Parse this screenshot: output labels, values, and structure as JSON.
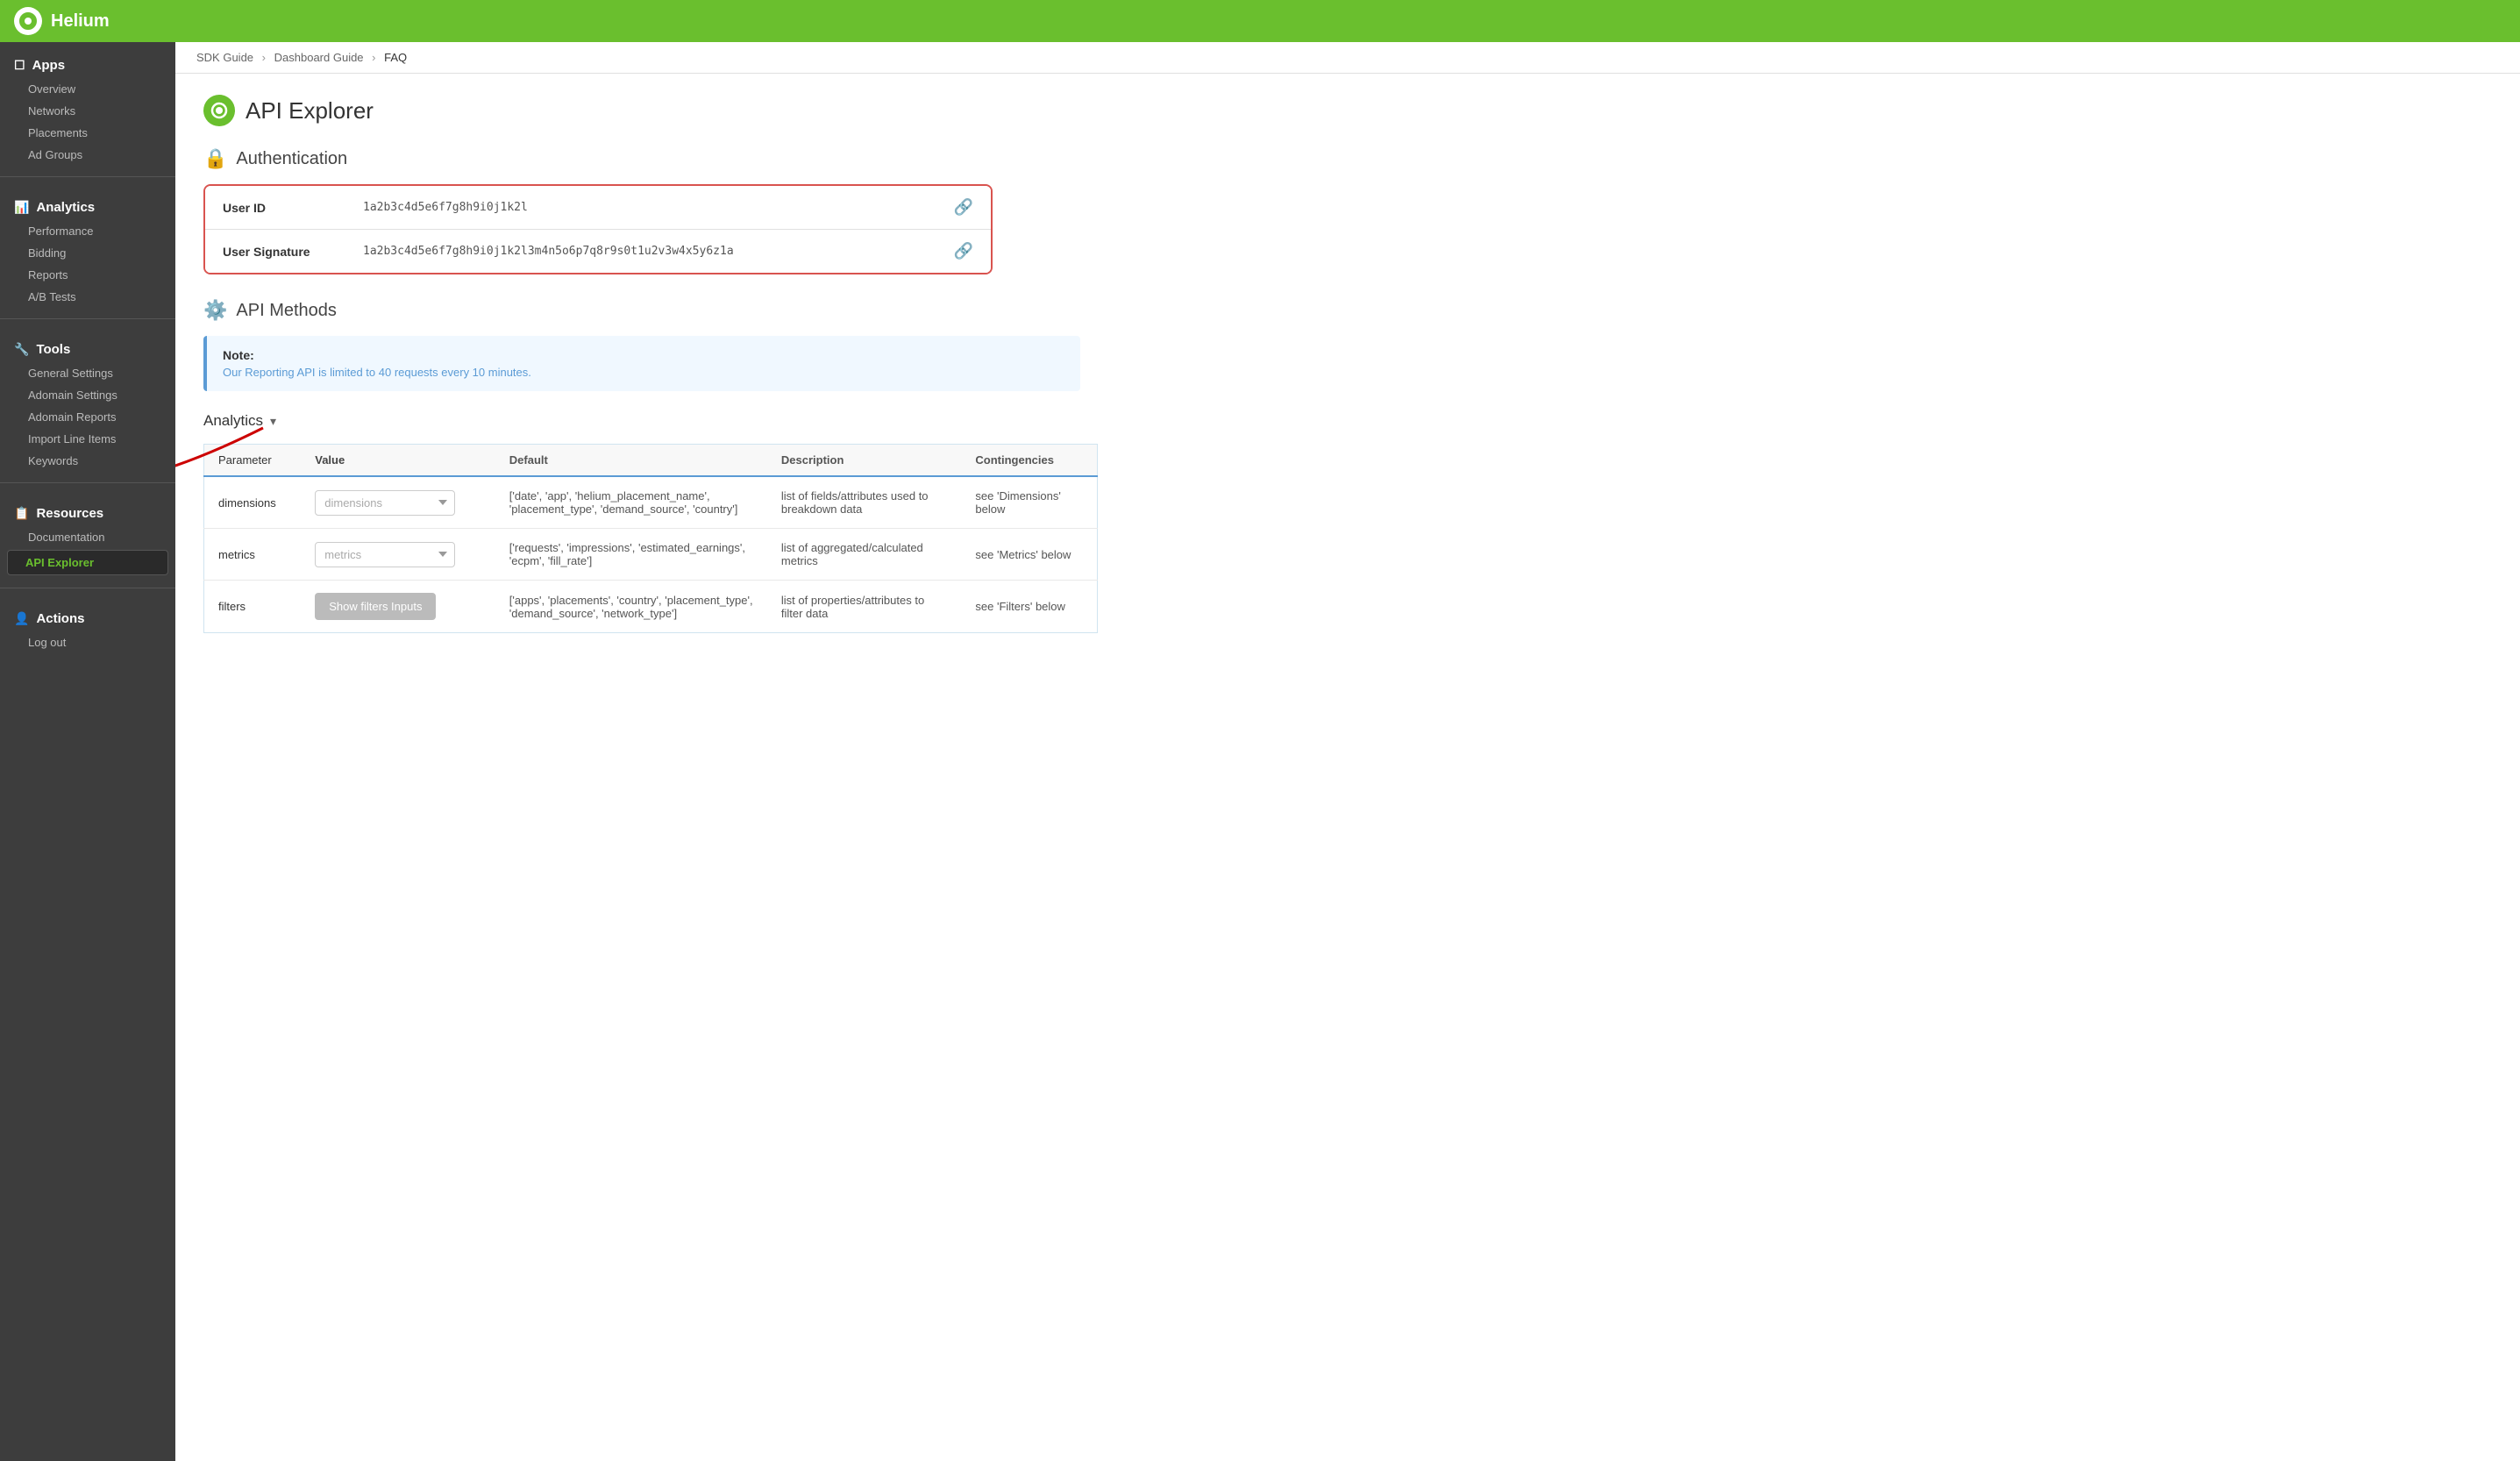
{
  "topbar": {
    "logo_text": "Helium"
  },
  "breadcrumb": {
    "items": [
      "SDK Guide",
      "Dashboard Guide",
      "FAQ"
    ],
    "separators": [
      "›",
      "›"
    ]
  },
  "sidebar": {
    "sections": [
      {
        "id": "apps",
        "icon": "📱",
        "label": "Apps",
        "items": [
          "Overview",
          "Networks",
          "Placements",
          "Ad Groups"
        ]
      },
      {
        "id": "analytics",
        "icon": "📊",
        "label": "Analytics",
        "items": [
          "Performance",
          "Bidding",
          "Reports",
          "A/B Tests"
        ]
      },
      {
        "id": "tools",
        "icon": "🔧",
        "label": "Tools",
        "items": [
          "General Settings",
          "Adomain Settings",
          "Adomain Reports",
          "Import Line Items",
          "Keywords"
        ]
      },
      {
        "id": "resources",
        "icon": "📋",
        "label": "Resources",
        "items": [
          "Documentation",
          "API Explorer"
        ]
      },
      {
        "id": "actions",
        "icon": "👤",
        "label": "Actions",
        "items": [
          "Log out"
        ]
      }
    ]
  },
  "page": {
    "title": "API Explorer",
    "auth_section_title": "Authentication",
    "api_methods_title": "API Methods",
    "analytics_toggle": "Analytics",
    "note_title": "Note:",
    "note_body": "Our Reporting API is limited to 40 requests every 10 minutes.",
    "user_id_label": "User ID",
    "user_id_value": "1a2b3c4d5e6f7g8h9i0j1k2l",
    "user_signature_label": "User Signature",
    "user_signature_value": "1a2b3c4d5e6f7g8h9i0j1k2l3m4n5o6p7q8r9s0t1u2v3w4x5y6z1a",
    "table": {
      "columns": [
        "Parameter",
        "Value",
        "Default",
        "Description",
        "Contingencies"
      ],
      "rows": [
        {
          "parameter": "dimensions",
          "value_placeholder": "dimensions",
          "default": "['date', 'app', 'helium_placement_name', 'placement_type', 'demand_source', 'country']",
          "description": "list of fields/attributes used to breakdown data",
          "contingencies": "see 'Dimensions' below"
        },
        {
          "parameter": "metrics",
          "value_placeholder": "metrics",
          "default": "['requests', 'impressions', 'estimated_earnings', 'ecpm', 'fill_rate']",
          "description": "list of aggregated/calculated metrics",
          "contingencies": "see 'Metrics' below"
        },
        {
          "parameter": "filters",
          "value_placeholder": "",
          "value_button": "Show filters Inputs",
          "default": "['apps', 'placements', 'country', 'placement_type', 'demand_source', 'network_type']",
          "description": "list of properties/attributes to filter data",
          "contingencies": "see 'Filters' below"
        }
      ]
    }
  }
}
